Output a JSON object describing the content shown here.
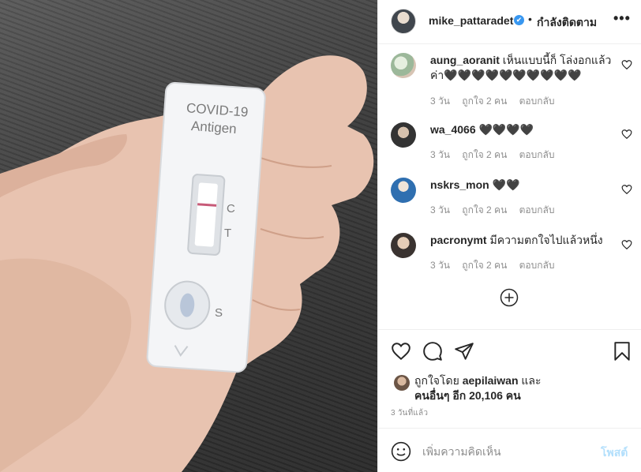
{
  "photo": {
    "cassette_title": "COVID-19",
    "cassette_subtitle": "Antigen",
    "label_c": "C",
    "label_t": "T",
    "label_s": "S"
  },
  "header": {
    "username": "mike_pattaradet",
    "verified_icon": "✔",
    "separator": "•",
    "follow_status": "กำลังติดตาม",
    "more_icon": "•••"
  },
  "comments": [
    {
      "username": "aung_aoranit",
      "text": "เห็นแบบนี้ก็ โล่งอกแล้วค่า🖤🖤🖤🖤🖤🖤🖤🖤🖤🖤",
      "time": "3 วัน",
      "likes": "ถูกใจ 2 คน",
      "reply": "ตอบกลับ"
    },
    {
      "username": "wa_4066",
      "text": "🖤🖤🖤🖤",
      "time": "3 วัน",
      "likes": "ถูกใจ 2 คน",
      "reply": "ตอบกลับ"
    },
    {
      "username": "nskrs_mon",
      "text": "🖤🖤",
      "time": "3 วัน",
      "likes": "ถูกใจ 2 คน",
      "reply": "ตอบกลับ"
    },
    {
      "username": "pacronymt",
      "text": "มีความตกใจไปแล้วหนึ่ง",
      "time": "3 วัน",
      "likes": "ถูกใจ 2 คน",
      "reply": "ตอบกลับ"
    }
  ],
  "likes": {
    "prefix": "ถูกใจโดย",
    "user": "aepilaiwan",
    "and": "และ",
    "others": "คนอื่นๆ อีก 20,106 คน"
  },
  "timestamp": "3 วันที่แล้ว",
  "composer": {
    "placeholder": "เพิ่มความคิดเห็น",
    "post_label": "โพสต์"
  },
  "colors": {
    "accent": "#3897f0",
    "post_disabled": "#b2dffc",
    "muted": "#8e8e8e",
    "text": "#262626",
    "border": "#efefef"
  }
}
